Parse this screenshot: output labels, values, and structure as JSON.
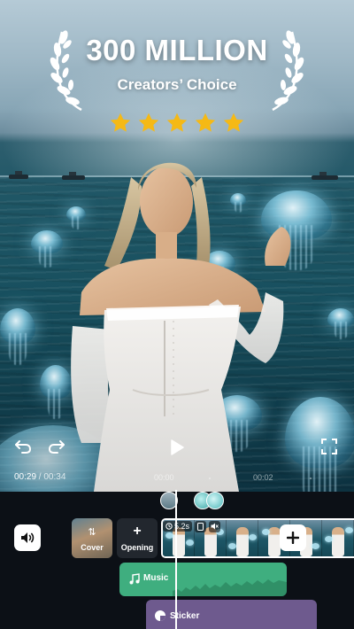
{
  "banner": {
    "headline": "300 MILLION",
    "subtitle": "Creators’ Choice",
    "rating_stars": 5,
    "star_color": "#f5b915"
  },
  "player": {
    "current_time": "00:29",
    "separator": " / ",
    "total_time": "00:34"
  },
  "ruler": {
    "marks": [
      "00:00",
      "00:02"
    ]
  },
  "timeline": {
    "cover_label": "Cover",
    "opening_label": "Opening",
    "clip_duration": "5.2s",
    "music_label": "Music",
    "sticker_label": "Sticker"
  },
  "colors": {
    "music_track": "#3fae7f",
    "sticker_track": "#6e5a8e",
    "timeline_bg": "#0c1016"
  },
  "icons": {
    "undo": "undo-icon",
    "redo": "redo-icon",
    "play": "play-icon",
    "fullscreen": "fullscreen-icon",
    "volume": "volume-icon",
    "add": "plus-icon"
  }
}
